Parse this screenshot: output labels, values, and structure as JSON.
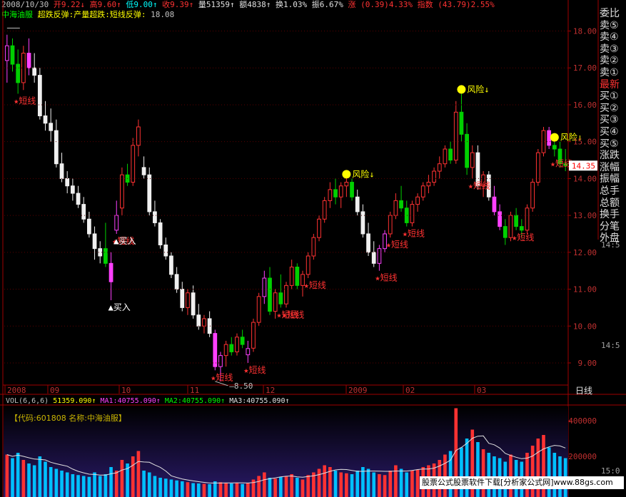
{
  "header": {
    "date": "2008/10/30",
    "quote": [
      {
        "label": "开",
        "value": "9.22",
        "arrow": "↓"
      },
      {
        "label": "高",
        "value": "9.60",
        "arrow": "↑"
      },
      {
        "label": "低",
        "value": "9.00",
        "arrow": "↑"
      },
      {
        "label": "收",
        "value": "9.39",
        "arrow": "↑"
      },
      {
        "label": "量",
        "value": "51359",
        "arrow": "↑"
      },
      {
        "label": "额",
        "value": "4838",
        "arrow": "↑"
      },
      {
        "label": "换",
        "value": "1.03%",
        "arrow": ""
      },
      {
        "label": "振",
        "value": "6.67%",
        "arrow": ""
      }
    ],
    "change": "涨 (0.39)4.33%",
    "index": "指数 (43.79)2.55%",
    "row2_stock": "中海油服",
    "row2_formula": "超跌反弹:产量超跌:短线反弹:",
    "row2_value": "18.08"
  },
  "side_panel": {
    "items": [
      "委比",
      "卖⑤",
      "卖④",
      "卖③",
      "卖②",
      "卖①",
      "最新",
      "买①",
      "买②",
      "买③",
      "买④",
      "买⑤",
      "涨跌",
      "涨幅",
      "振幅",
      "总手",
      "总额",
      "换手",
      "分笔",
      "外盘"
    ]
  },
  "price_axis": {
    "ticks": [
      "18.00",
      "17.00",
      "16.00",
      "15.00",
      "14.00",
      "13.00",
      "12.00",
      "11.00",
      "10.00",
      "9.00"
    ],
    "current_price": "14.35",
    "right_edge_labels": [
      "14:5",
      "14:5",
      "15:0"
    ]
  },
  "time_axis": {
    "labels": [
      "2008",
      "09",
      "10",
      "11",
      "12",
      "2009",
      "02",
      "03"
    ],
    "period": "日线"
  },
  "volume_header": {
    "indicator": "VOL(6,6,6)",
    "vol": "51359.090",
    "ma1_label": "MA1:",
    "ma1": "40755.090",
    "ma2_label": "MA2:",
    "ma2": "40755.090",
    "ma3_label": "MA3:",
    "ma3": "40755.090",
    "stock_info": "【代码:601808 名称:中海油服】"
  },
  "volume_axis": {
    "ticks": [
      "400000",
      "200000"
    ]
  },
  "annotations": {
    "buy": "买入",
    "short": "短线",
    "risk": "风险",
    "low_mark": "8.50",
    "high_mark": "18.08"
  },
  "watermark": "股票公式股票软件下载[分析家公式网]www.88gs.com",
  "colors": {
    "up": "#ff3232",
    "down_body": "#00d000",
    "white": "#f0f0f0",
    "magenta": "#ff40ff",
    "axis": "#a00000",
    "yellow": "#ffff00",
    "volume": "#00c0ff"
  },
  "chart_data": {
    "type": "candlestick",
    "ylim": [
      8.4,
      18.3
    ],
    "candles": [
      [
        17.2,
        17.9,
        16.6,
        17.6
      ],
      [
        17.6,
        17.8,
        16.9,
        17.1
      ],
      [
        17.1,
        17.5,
        16.3,
        16.6
      ],
      [
        16.6,
        17.6,
        16.4,
        17.4
      ],
      [
        17.4,
        17.8,
        16.8,
        17.0
      ],
      [
        17.0,
        17.4,
        16.6,
        16.8
      ],
      [
        16.8,
        17.0,
        15.6,
        15.7
      ],
      [
        15.7,
        16.1,
        15.3,
        15.5
      ],
      [
        15.5,
        15.9,
        15.0,
        15.3
      ],
      [
        15.3,
        15.6,
        14.3,
        14.4
      ],
      [
        14.4,
        14.7,
        13.9,
        14.0
      ],
      [
        14.0,
        14.2,
        13.6,
        13.8
      ],
      [
        13.8,
        14.0,
        13.4,
        13.6
      ],
      [
        13.6,
        13.8,
        13.2,
        13.3
      ],
      [
        13.3,
        13.5,
        12.8,
        12.9
      ],
      [
        12.9,
        13.1,
        12.4,
        12.5
      ],
      [
        12.5,
        12.7,
        11.8,
        12.1
      ],
      [
        12.1,
        12.3,
        11.7,
        11.9
      ],
      [
        12.1,
        12.8,
        11.6,
        11.7
      ],
      [
        11.7,
        12.0,
        10.7,
        11.2
      ],
      [
        12.6,
        13.4,
        12.5,
        13.0
      ],
      [
        13.2,
        14.3,
        13.0,
        14.1
      ],
      [
        14.1,
        14.4,
        13.8,
        13.9
      ],
      [
        13.9,
        15.1,
        13.8,
        14.9
      ],
      [
        14.9,
        15.6,
        14.6,
        15.4
      ],
      [
        14.3,
        14.6,
        14.0,
        14.1
      ],
      [
        14.1,
        14.3,
        13.0,
        13.1
      ],
      [
        13.1,
        13.4,
        12.7,
        12.8
      ],
      [
        12.8,
        12.9,
        12.1,
        12.2
      ],
      [
        12.2,
        12.4,
        11.8,
        11.9
      ],
      [
        11.9,
        12.0,
        11.3,
        11.4
      ],
      [
        11.4,
        11.6,
        10.9,
        11.0
      ],
      [
        11.0,
        11.2,
        10.4,
        10.5
      ],
      [
        10.5,
        11.0,
        10.3,
        10.9
      ],
      [
        10.9,
        11.1,
        10.2,
        10.3
      ],
      [
        10.3,
        10.6,
        9.9,
        10.0
      ],
      [
        10.0,
        10.3,
        9.8,
        10.2
      ],
      [
        10.2,
        10.4,
        9.7,
        9.8
      ],
      [
        9.8,
        9.9,
        8.8,
        8.9
      ],
      [
        8.9,
        9.3,
        8.5,
        9.2
      ],
      [
        9.2,
        9.6,
        8.9,
        9.5
      ],
      [
        9.5,
        9.7,
        9.2,
        9.3
      ],
      [
        9.3,
        9.8,
        9.2,
        9.7
      ],
      [
        9.7,
        9.9,
        9.4,
        9.5
      ],
      [
        9.22,
        9.6,
        9.0,
        9.39
      ],
      [
        9.4,
        10.2,
        9.3,
        10.1
      ],
      [
        10.1,
        10.9,
        10.0,
        10.8
      ],
      [
        10.8,
        11.5,
        10.6,
        11.3
      ],
      [
        11.3,
        11.6,
        10.3,
        10.4
      ],
      [
        10.4,
        11.0,
        10.2,
        10.9
      ],
      [
        10.9,
        11.4,
        10.5,
        10.6
      ],
      [
        10.6,
        11.2,
        10.5,
        11.1
      ],
      [
        11.1,
        11.8,
        11.0,
        11.6
      ],
      [
        11.6,
        11.7,
        11.0,
        11.1
      ],
      [
        11.1,
        11.5,
        10.8,
        11.4
      ],
      [
        11.4,
        12.0,
        11.3,
        11.9
      ],
      [
        11.9,
        12.5,
        11.8,
        12.4
      ],
      [
        12.4,
        13.0,
        12.3,
        12.9
      ],
      [
        12.9,
        13.5,
        12.8,
        13.4
      ],
      [
        13.4,
        13.9,
        13.2,
        13.7
      ],
      [
        13.7,
        14.0,
        13.3,
        13.5
      ],
      [
        13.5,
        13.9,
        13.2,
        13.8
      ],
      [
        13.8,
        14.0,
        13.5,
        13.9
      ],
      [
        13.9,
        14.0,
        13.4,
        13.5
      ],
      [
        13.5,
        13.7,
        13.0,
        13.1
      ],
      [
        13.1,
        13.3,
        12.4,
        12.5
      ],
      [
        12.5,
        12.8,
        11.9,
        12.0
      ],
      [
        12.0,
        12.3,
        11.6,
        11.7
      ],
      [
        11.7,
        12.2,
        11.5,
        12.1
      ],
      [
        12.1,
        12.6,
        12.0,
        12.5
      ],
      [
        12.5,
        13.1,
        12.4,
        13.0
      ],
      [
        13.0,
        13.6,
        12.9,
        13.4
      ],
      [
        13.4,
        13.8,
        13.1,
        13.2
      ],
      [
        13.2,
        13.4,
        12.7,
        12.8
      ],
      [
        12.8,
        13.4,
        12.7,
        13.3
      ],
      [
        13.3,
        13.6,
        13.1,
        13.5
      ],
      [
        13.5,
        13.9,
        13.4,
        13.8
      ],
      [
        13.8,
        14.1,
        13.6,
        13.9
      ],
      [
        13.9,
        14.3,
        13.8,
        14.2
      ],
      [
        14.2,
        14.6,
        14.0,
        14.4
      ],
      [
        14.4,
        14.9,
        14.3,
        14.8
      ],
      [
        14.8,
        15.0,
        14.4,
        14.5
      ],
      [
        14.5,
        16.1,
        14.4,
        15.8
      ],
      [
        15.8,
        16.3,
        15.0,
        15.2
      ],
      [
        15.2,
        15.5,
        14.1,
        14.3
      ],
      [
        14.3,
        14.9,
        14.0,
        14.7
      ],
      [
        14.7,
        14.9,
        13.7,
        13.8
      ],
      [
        13.8,
        14.2,
        13.5,
        14.1
      ],
      [
        14.1,
        14.2,
        13.4,
        13.5
      ],
      [
        13.5,
        13.8,
        13.0,
        13.1
      ],
      [
        13.1,
        13.3,
        12.6,
        12.7
      ],
      [
        12.7,
        12.9,
        12.2,
        12.4
      ],
      [
        12.4,
        13.1,
        12.3,
        13.0
      ],
      [
        13.0,
        13.2,
        12.6,
        12.7
      ],
      [
        12.7,
        12.9,
        12.4,
        12.6
      ],
      [
        12.6,
        13.3,
        12.5,
        13.2
      ],
      [
        13.2,
        14.0,
        13.1,
        13.9
      ],
      [
        13.9,
        14.8,
        13.8,
        14.7
      ],
      [
        14.7,
        15.4,
        14.6,
        15.3
      ],
      [
        15.3,
        15.4,
        14.8,
        14.9
      ],
      [
        14.9,
        15.0,
        14.6,
        14.8
      ],
      [
        14.8,
        15.0,
        14.3,
        14.4
      ],
      [
        14.4,
        14.8,
        14.2,
        14.35
      ]
    ],
    "volume_ylim": [
      0,
      480000
    ],
    "volumes": [
      210000,
      190000,
      220000,
      180000,
      160000,
      150000,
      200000,
      170000,
      140000,
      130000,
      120000,
      110000,
      100000,
      95000,
      90000,
      85000,
      110000,
      90000,
      100000,
      140000,
      120000,
      180000,
      160000,
      200000,
      230000,
      120000,
      110000,
      90000,
      80000,
      75000,
      70000,
      65000,
      60000,
      55000,
      50000,
      48000,
      46000,
      44000,
      60000,
      55000,
      52000,
      48000,
      50000,
      45000,
      51359,
      70000,
      90000,
      110000,
      80000,
      75000,
      85000,
      90000,
      100000,
      80000,
      70000,
      95000,
      110000,
      130000,
      150000,
      140000,
      120000,
      110000,
      105000,
      100000,
      120000,
      140000,
      130000,
      110000,
      100000,
      95000,
      120000,
      150000,
      130000,
      110000,
      120000,
      125000,
      140000,
      150000,
      160000,
      180000,
      210000,
      230000,
      470000,
      250000,
      300000,
      350000,
      280000,
      240000,
      220000,
      200000,
      190000,
      170000,
      210000,
      180000,
      170000,
      220000,
      260000,
      300000,
      320000,
      250000,
      220000,
      200000,
      190000
    ],
    "signals": [
      {
        "type": "short",
        "index": 2
      },
      {
        "type": "short",
        "index": 20
      },
      {
        "type": "buy",
        "index": 20
      },
      {
        "type": "buy",
        "index": 19
      },
      {
        "type": "short",
        "index": 38
      },
      {
        "type": "short",
        "index": 44
      },
      {
        "type": "short",
        "index": 50
      },
      {
        "type": "short",
        "index": 51
      },
      {
        "type": "short",
        "index": 55
      },
      {
        "type": "short",
        "index": 68
      },
      {
        "type": "short",
        "index": 70
      },
      {
        "type": "short",
        "index": 73
      },
      {
        "type": "short",
        "index": 85
      },
      {
        "type": "short",
        "index": 93
      },
      {
        "type": "short",
        "index": 100
      },
      {
        "type": "risk",
        "index": 62
      },
      {
        "type": "risk",
        "index": 83
      },
      {
        "type": "risk",
        "index": 100
      }
    ]
  }
}
